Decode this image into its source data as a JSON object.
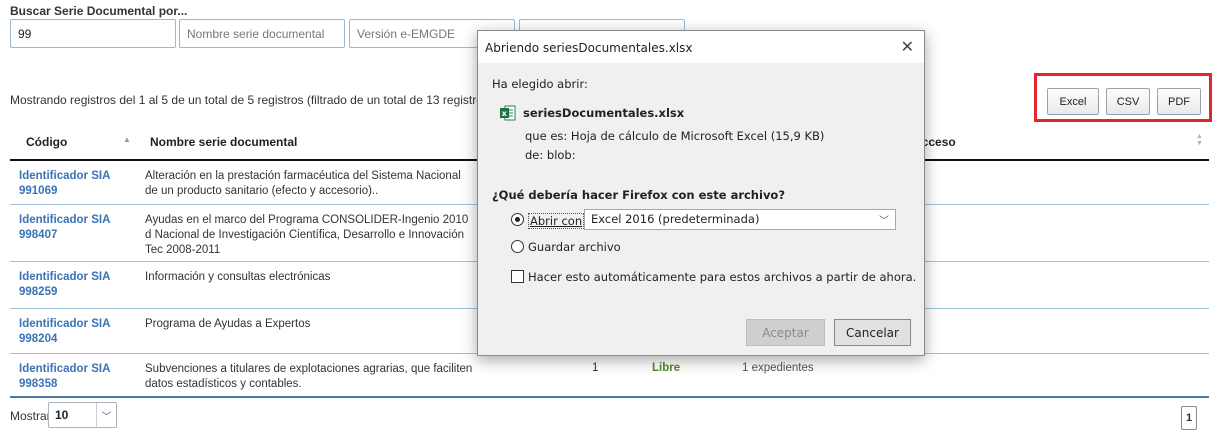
{
  "search": {
    "title": "Buscar Serie Documental por...",
    "code_value": "99",
    "name_placeholder": "Nombre serie documental",
    "version_placeholder": "Versión e-EMGDE"
  },
  "records_info": "Mostrando registros del 1 al 5 de un total de 5 registros (filtrado de un total de 13 registros)",
  "export": {
    "excel": "Excel",
    "csv": "CSV",
    "pdf": "PDF",
    "highlight_color": "#e3262b"
  },
  "table": {
    "headers": {
      "code": "Código",
      "name": "Nombre serie documental",
      "access": "Acceso"
    },
    "rows": [
      {
        "code": "Identificador SIA 991069",
        "name": "Alteración en la prestación farmacéutica del Sistema Nacional de un producto sanitario (efecto y accesorio)..",
        "count": "",
        "access": "",
        "files": ""
      },
      {
        "code": "Identificador SIA 998407",
        "name": "Ayudas en el marco del Programa CONSOLIDER-Ingenio 2010 d Nacional de Investigación Científica, Desarrollo e Innovación Tec 2008-2011",
        "count": "",
        "access": "",
        "files": ""
      },
      {
        "code": "Identificador SIA 998259",
        "name": "Información y consultas electrónicas",
        "count": "",
        "access": "",
        "files": ""
      },
      {
        "code": "Identificador SIA 998204",
        "name": "Programa de Ayudas a Expertos",
        "count": "",
        "access": "",
        "files": ""
      },
      {
        "code": "Identificador SIA 998358",
        "name": "Subvenciones a titulares de explotaciones agrarias, que faciliten datos estadísticos y contables.",
        "count": "1",
        "access": "Libre",
        "files": "1 expedientes"
      }
    ]
  },
  "pagination": {
    "show_label": "Mostrar",
    "page_size": "10",
    "current_page": "1"
  },
  "dialog": {
    "title": "Abriendo seriesDocumentales.xlsx",
    "chosen_label": "Ha elegido abrir:",
    "filename": "seriesDocumentales.xlsx",
    "type_line": "que es: Hoja de cálculo de Microsoft Excel (15,9 KB)",
    "from_line": "de: blob:",
    "question": "¿Qué debería hacer Firefox con este archivo?",
    "open_with_label": "Abrir con",
    "open_with_app": "Excel 2016 (predeterminada)",
    "save_label": "Guardar archivo",
    "auto_label": "Hacer esto automáticamente para estos archivos a partir de ahora.",
    "accept_label": "Aceptar",
    "cancel_label": "Cancelar",
    "close_icon": "close-icon"
  }
}
